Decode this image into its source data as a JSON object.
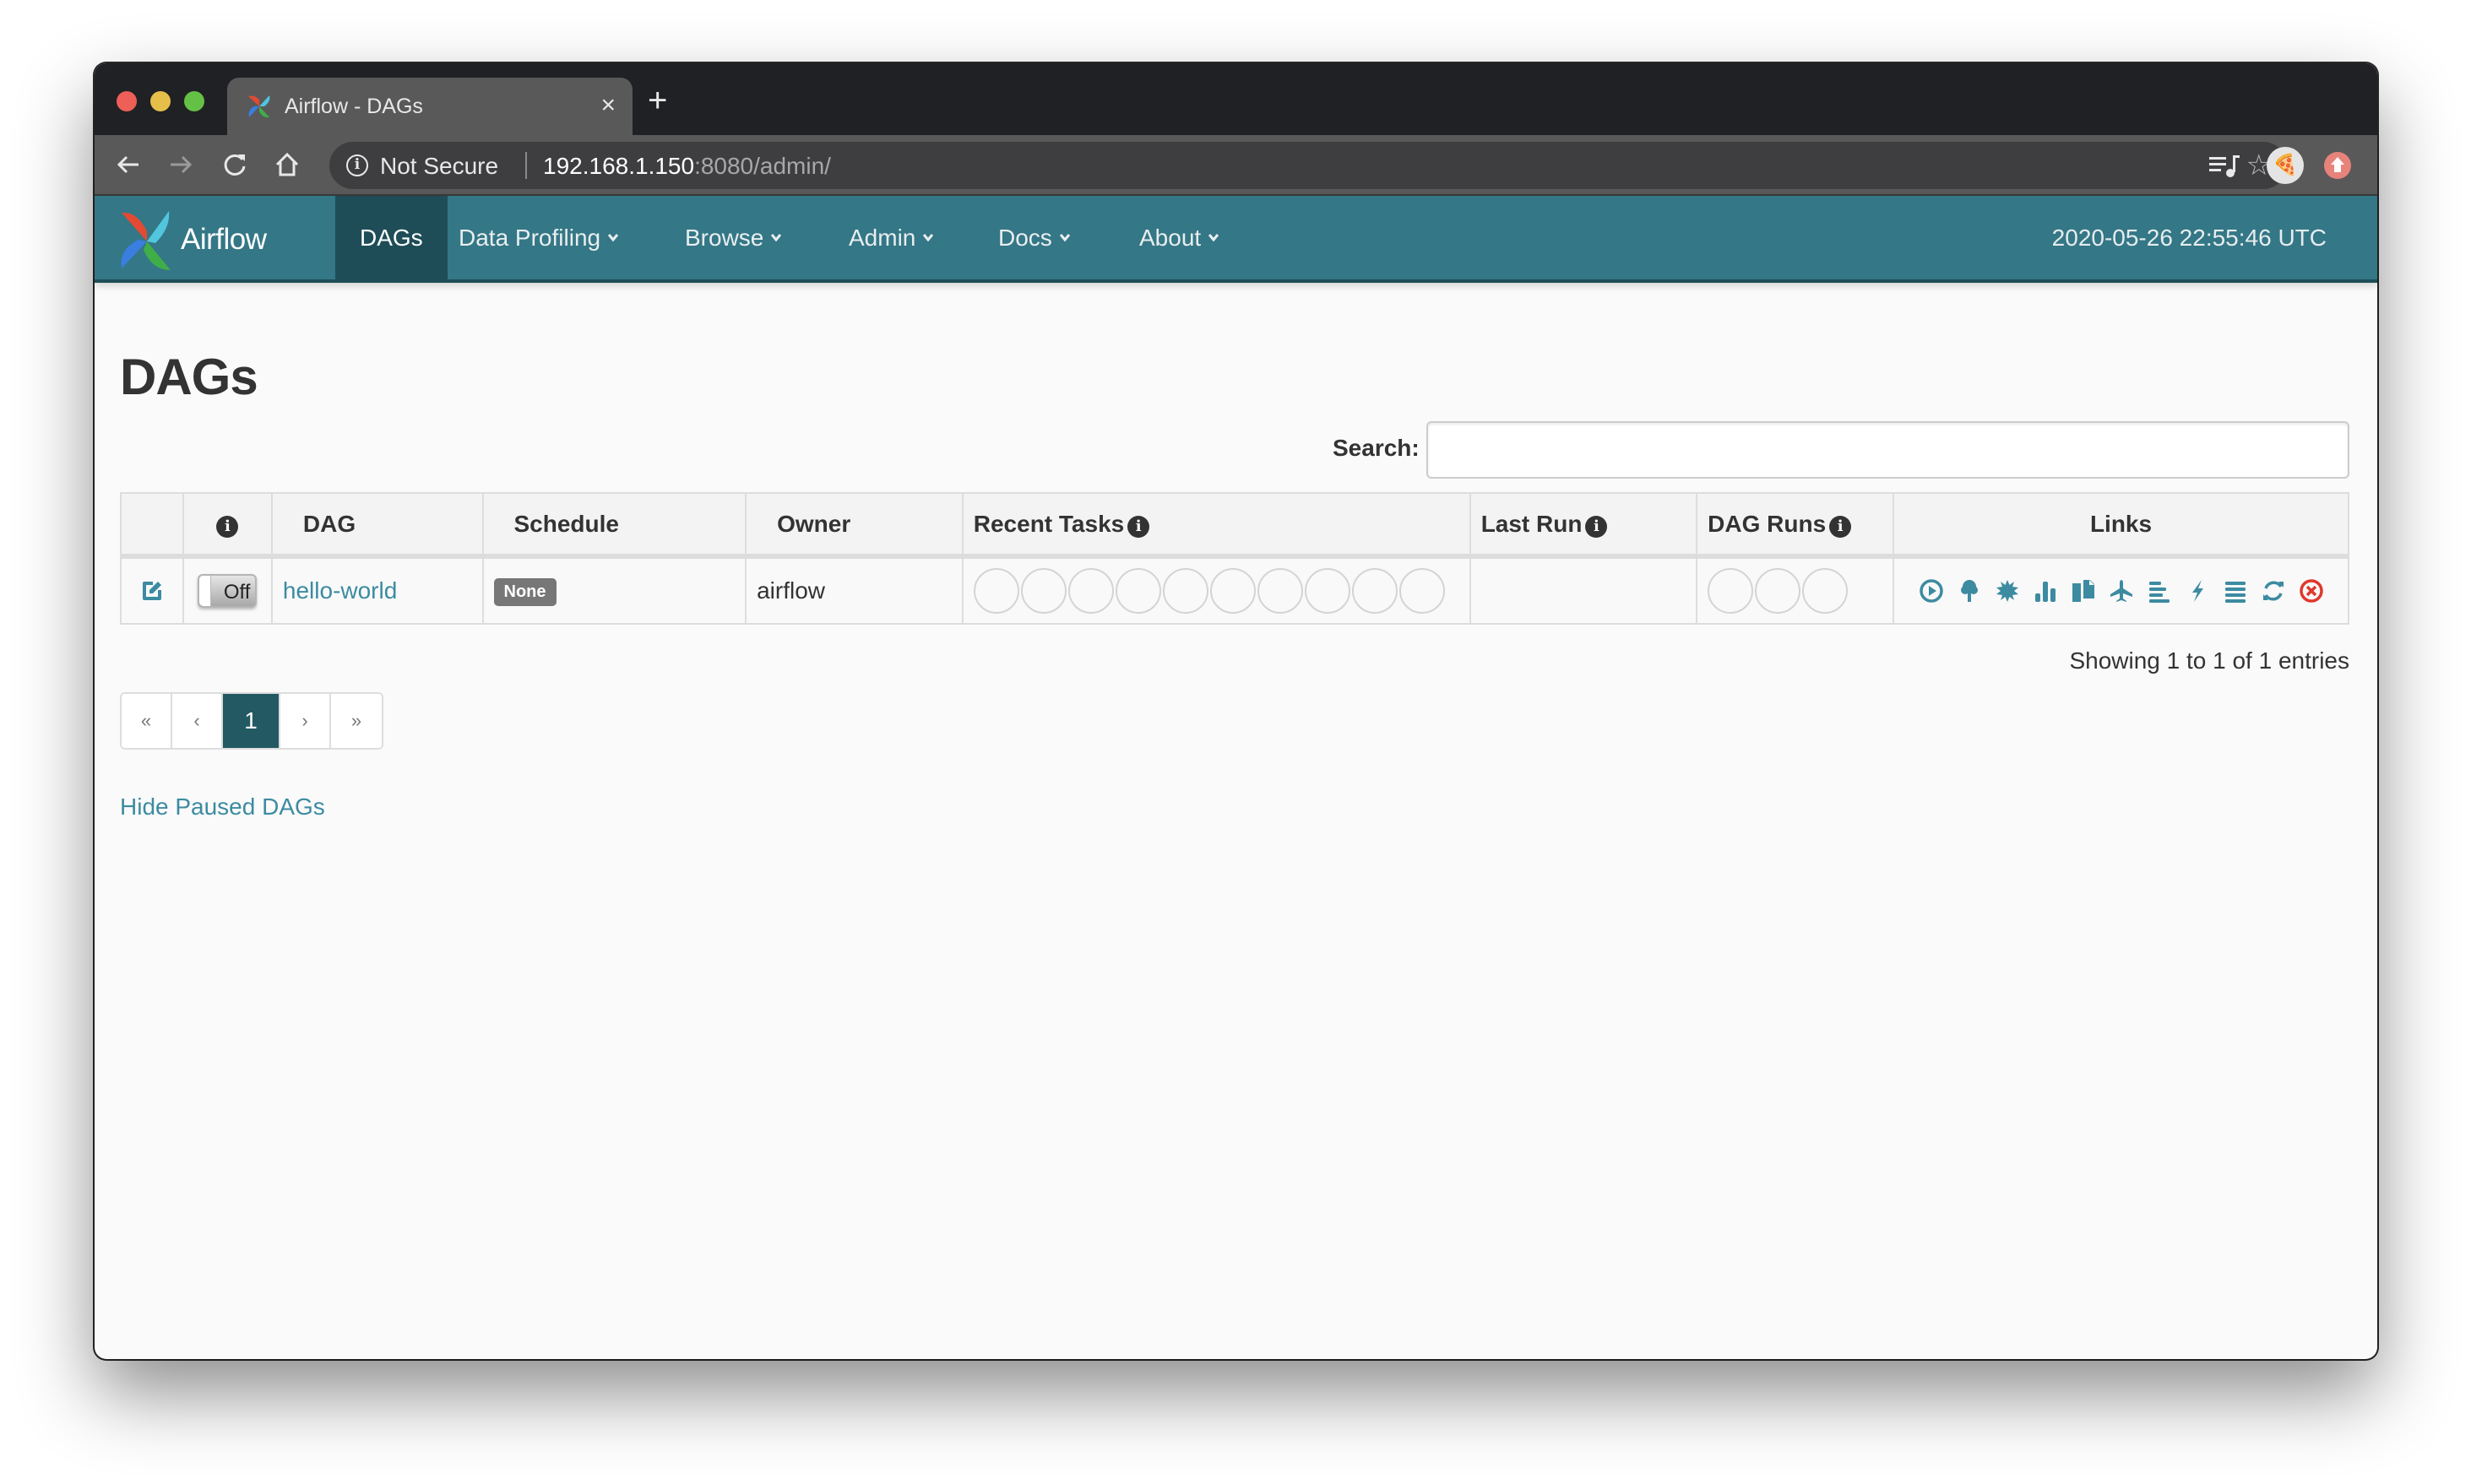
{
  "browser": {
    "tab_title": "Airflow - DAGs",
    "tab_close": "×",
    "new_tab": "+",
    "security_label": "Not Secure",
    "url_host": "192.168.1.150",
    "url_rest": ":8080/admin/",
    "avatar_emoji": "🍕"
  },
  "navbar": {
    "brand": "Airflow",
    "items": [
      {
        "label": "DAGs",
        "active": true
      },
      {
        "label": "Data Profiling",
        "dropdown": true
      },
      {
        "label": "Browse",
        "dropdown": true
      },
      {
        "label": "Admin",
        "dropdown": true
      },
      {
        "label": "Docs",
        "dropdown": true
      },
      {
        "label": "About",
        "dropdown": true
      }
    ],
    "timestamp": "2020-05-26 22:55:46 UTC"
  },
  "page": {
    "title": "DAGs",
    "search_label": "Search:",
    "search_value": "",
    "search_placeholder": ""
  },
  "table": {
    "headers": {
      "info": "i",
      "dag": "DAG",
      "schedule": "Schedule",
      "owner": "Owner",
      "recent_tasks": "Recent Tasks",
      "last_run": "Last Run",
      "dag_runs": "DAG Runs",
      "links": "Links"
    },
    "rows": [
      {
        "toggle": "Off",
        "dag_id": "hello-world",
        "schedule": "None",
        "owner": "airflow",
        "recent_tasks_count": 10,
        "last_run": "",
        "dag_runs_count": 3
      }
    ],
    "link_icons": [
      {
        "name": "trigger-dag-icon",
        "color": "#3c8ba1"
      },
      {
        "name": "tree-view-icon",
        "color": "#3c8ba1"
      },
      {
        "name": "graph-view-icon",
        "color": "#3c8ba1"
      },
      {
        "name": "task-duration-icon",
        "color": "#3c8ba1"
      },
      {
        "name": "task-tries-icon",
        "color": "#3c8ba1"
      },
      {
        "name": "landing-times-icon",
        "color": "#3c8ba1"
      },
      {
        "name": "gantt-icon",
        "color": "#3c8ba1"
      },
      {
        "name": "code-view-icon",
        "color": "#3c8ba1"
      },
      {
        "name": "logs-icon",
        "color": "#3c8ba1"
      },
      {
        "name": "refresh-icon",
        "color": "#3c8ba1"
      },
      {
        "name": "delete-dag-icon",
        "color": "#e0382c"
      }
    ]
  },
  "footer": {
    "showing": "Showing 1 to 1 of 1 entries",
    "pagination": {
      "first": "«",
      "prev": "‹",
      "current": "1",
      "next": "›",
      "last": "»"
    },
    "hide_paused": "Hide Paused DAGs"
  },
  "colors": {
    "navbar": "#347786",
    "nav_active": "#1e4d57",
    "link": "#3c8ba1",
    "page_active": "#235963",
    "danger": "#e0382c"
  }
}
